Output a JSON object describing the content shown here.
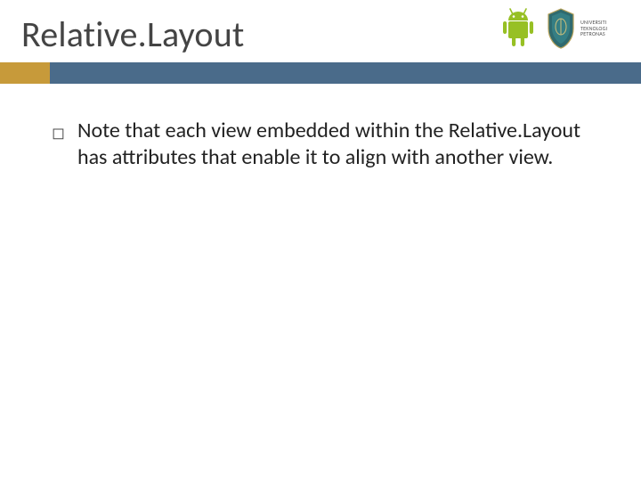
{
  "title": "Relative.Layout",
  "logos": {
    "university_text": "UNIVERSITI TEKNOLOGI PETRONAS"
  },
  "bullets": [
    "Note that each view embedded within the Relative.Layout has attributes that enable it to align with another view."
  ]
}
